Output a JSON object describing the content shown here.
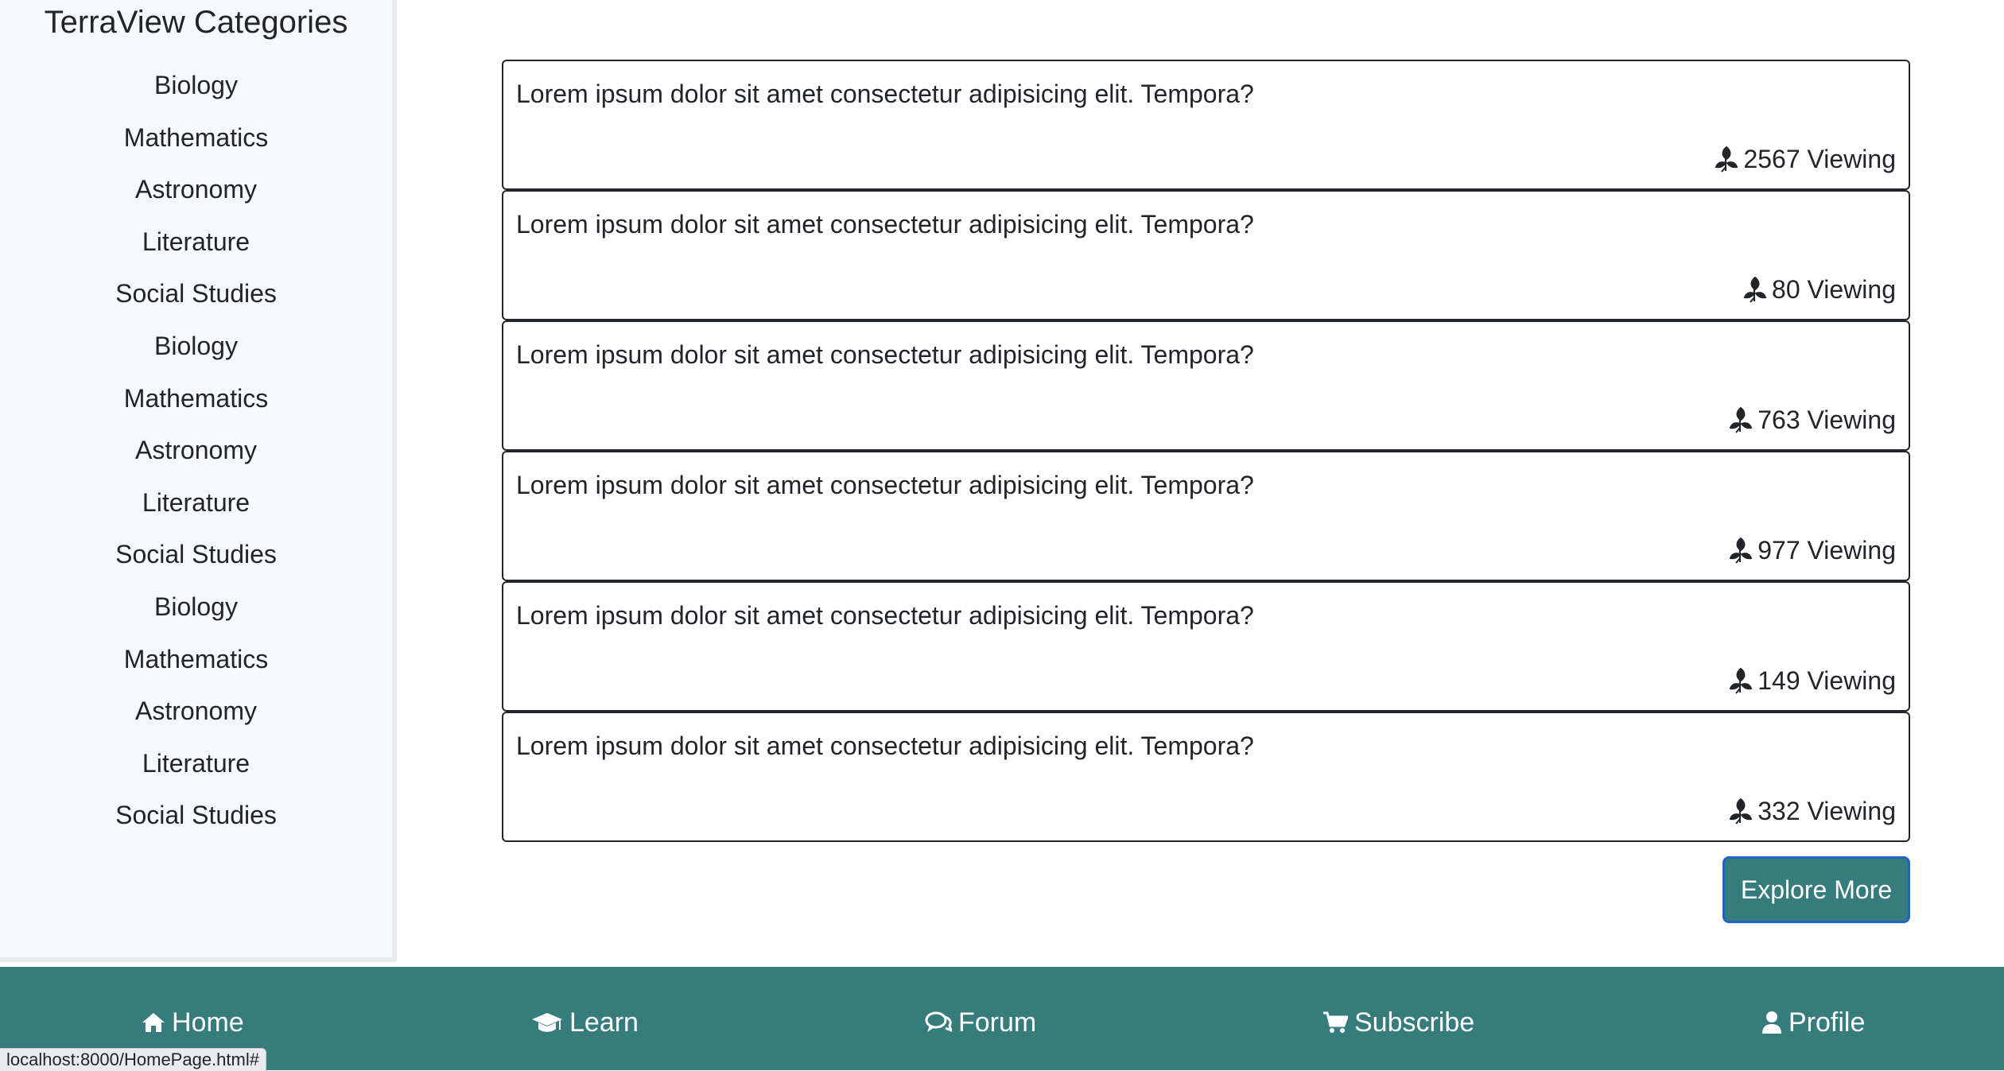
{
  "sidebar": {
    "title": "TerraView Categories",
    "categories": [
      "Biology",
      "Mathematics",
      "Astronomy",
      "Literature",
      "Social Studies",
      "Biology",
      "Mathematics",
      "Astronomy",
      "Literature",
      "Social Studies",
      "Biology",
      "Mathematics",
      "Astronomy",
      "Literature",
      "Social Studies"
    ]
  },
  "posts": [
    {
      "text": "Lorem ipsum dolor sit amet consectetur adipisicing elit. Tempora?",
      "views": "2567 Viewing"
    },
    {
      "text": "Lorem ipsum dolor sit amet consectetur adipisicing elit. Tempora?",
      "views": "80 Viewing"
    },
    {
      "text": "Lorem ipsum dolor sit amet consectetur adipisicing elit. Tempora?",
      "views": "763 Viewing"
    },
    {
      "text": "Lorem ipsum dolor sit amet consectetur adipisicing elit. Tempora?",
      "views": "977 Viewing"
    },
    {
      "text": "Lorem ipsum dolor sit amet consectetur adipisicing elit. Tempora?",
      "views": "149 Viewing"
    },
    {
      "text": "Lorem ipsum dolor sit amet consectetur adipisicing elit. Tempora?",
      "views": "332 Viewing"
    }
  ],
  "explore_button": "Explore More",
  "footer_nav": [
    {
      "label": "Home",
      "icon": "home-icon"
    },
    {
      "label": "Learn",
      "icon": "graduation-cap-icon"
    },
    {
      "label": "Forum",
      "icon": "comments-icon"
    },
    {
      "label": "Subscribe",
      "icon": "cart-icon"
    },
    {
      "label": "Profile",
      "icon": "user-icon"
    }
  ],
  "status_bar_url": "localhost:8000/HomePage.html#",
  "colors": {
    "accent": "#377c7c",
    "sidebar_bg": "#f8f9fa",
    "button_border": "#1f65c9"
  }
}
